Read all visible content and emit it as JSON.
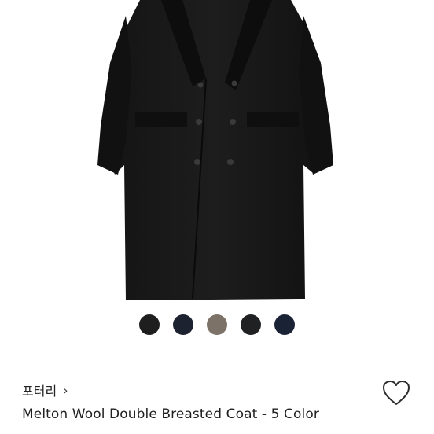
{
  "product": {
    "brand": "포터리",
    "brand_chevron": "›",
    "name": "Melton Wool Double Breasted Coat - 5 Color"
  },
  "swatches": [
    {
      "color": "#1e1e1e",
      "label": "black"
    },
    {
      "color": "#1c2230",
      "label": "dark navy"
    },
    {
      "color": "#7c7268",
      "label": "taupe"
    },
    {
      "color": "#202122",
      "label": "charcoal"
    },
    {
      "color": "#1a2236",
      "label": "navy"
    }
  ],
  "icons": {
    "wishlist": "heart-outline-icon",
    "brand_chevron": "chevron-right-icon"
  }
}
